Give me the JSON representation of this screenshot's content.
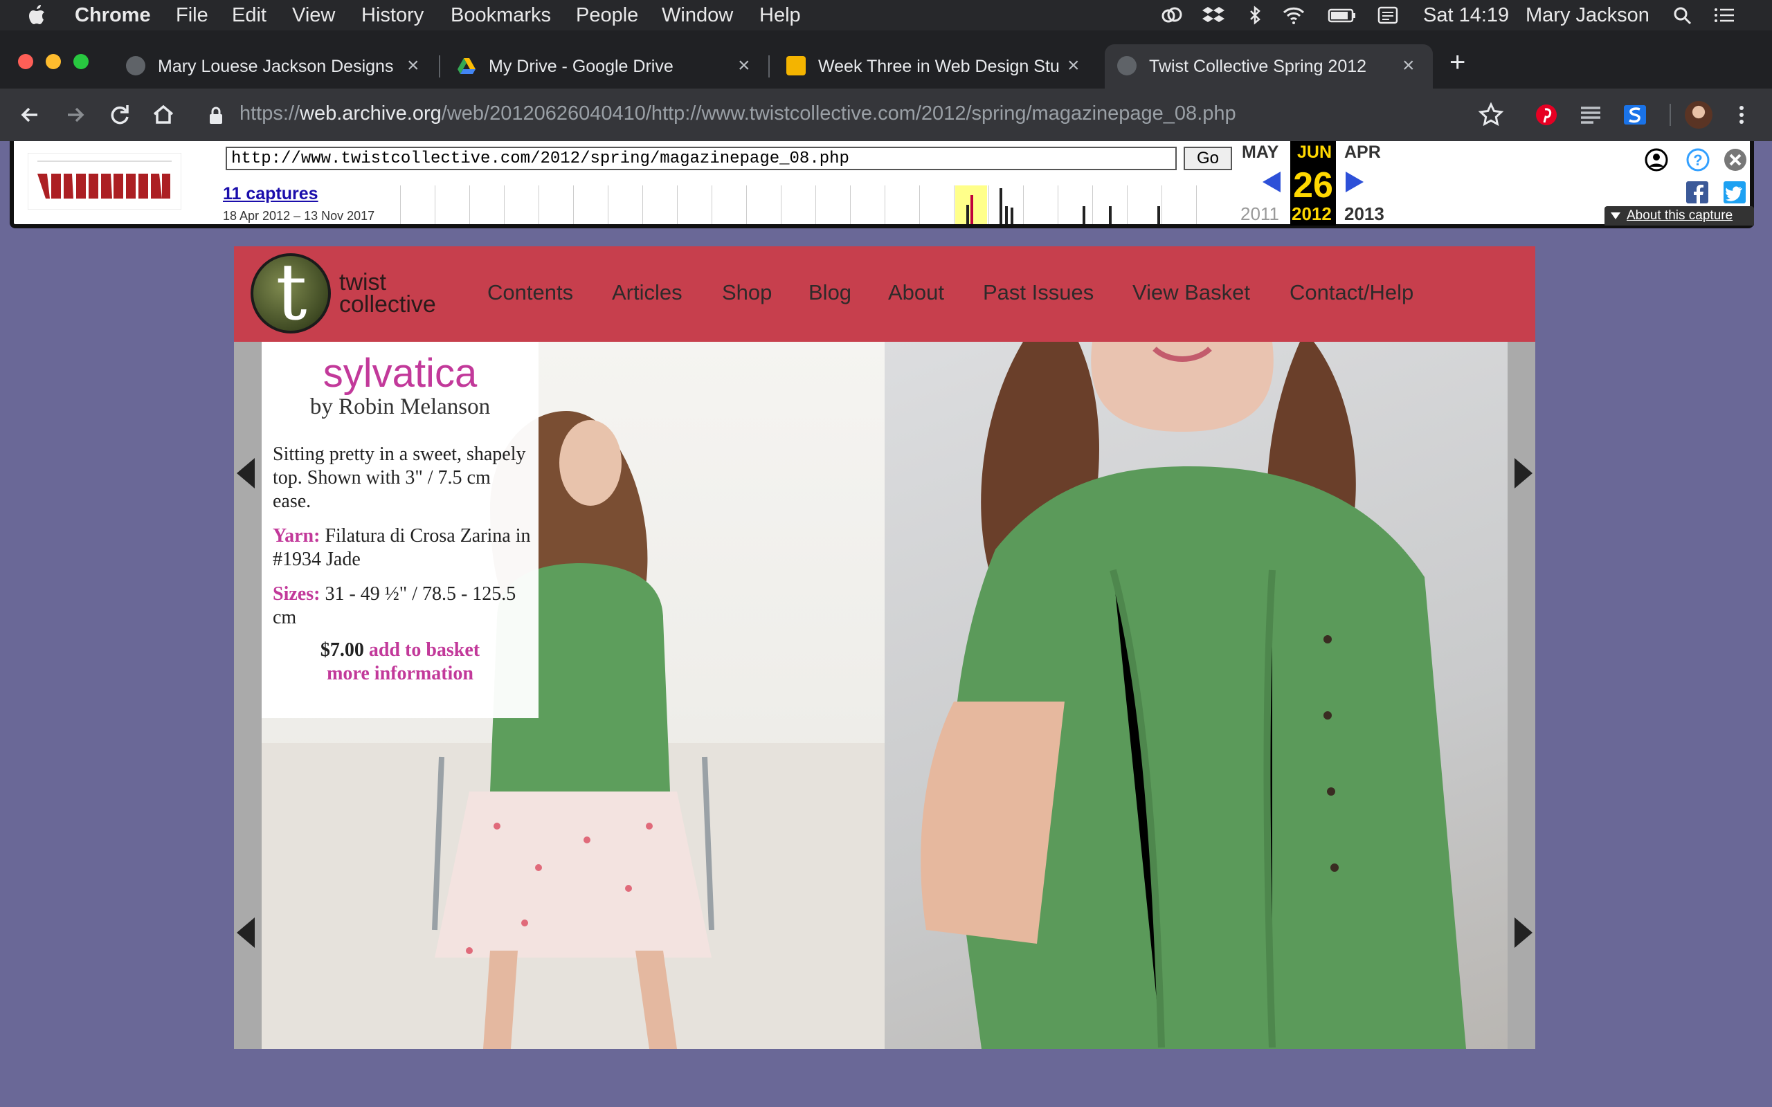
{
  "menubar": {
    "app": "Chrome",
    "items": [
      "File",
      "Edit",
      "View",
      "History",
      "Bookmarks",
      "People",
      "Window",
      "Help"
    ],
    "clock": "Sat 14:19",
    "user": "Mary Jackson"
  },
  "tabs": [
    {
      "title": "Mary Louese Jackson Designs",
      "icon": "globe-icon"
    },
    {
      "title": "My Drive - Google Drive",
      "icon": "google-drive-icon"
    },
    {
      "title": "Week Three in Web Design Stu",
      "icon": "slides-icon"
    },
    {
      "title": "Twist Collective Spring 2012",
      "icon": "globe-icon",
      "active": true
    }
  ],
  "toolbar": {
    "url_prefix": "https://",
    "url_host": "web.archive.org",
    "url_path": "/web/20120626040410/http://www.twistcollective.com/2012/spring/magazinepage_08.php"
  },
  "wayback": {
    "input_url": "http://www.twistcollective.com/2012/spring/magazinepage_08.php",
    "go_label": "Go",
    "captures_label": "11 captures",
    "range": "18 Apr 2012 – 13 Nov 2017",
    "prev_month": "MAY",
    "cur_month": "JUN",
    "next_month": "APR",
    "cur_day": "26",
    "prev_year": "2011",
    "cur_year": "2012",
    "next_year": "2013",
    "about": "About this capture"
  },
  "site": {
    "logo_line1": "twist",
    "logo_line2": "collective",
    "logo_letter": "t",
    "nav": [
      "Contents",
      "Articles",
      "Shop",
      "Blog",
      "About",
      "Past Issues",
      "View Basket",
      "Contact/Help"
    ]
  },
  "pattern": {
    "title": "sylvatica",
    "by": "by Robin Melanson",
    "description": "Sitting pretty in a sweet, shapely top. Shown with 3\" / 7.5 cm ease.",
    "yarn_label": "Yarn:",
    "yarn": "Filatura di Crosa Zarina in #1934 Jade",
    "sizes_label": "Sizes:",
    "sizes": "31 - 49 ½\" / 78.5 - 125.5 cm",
    "price": "$7.00",
    "add_to_basket": "add to basket",
    "more_info": "more information"
  },
  "colors": {
    "nav_bg": "#c73f4d",
    "accent_pink": "#c2399a",
    "page_bg": "#6a6897"
  }
}
